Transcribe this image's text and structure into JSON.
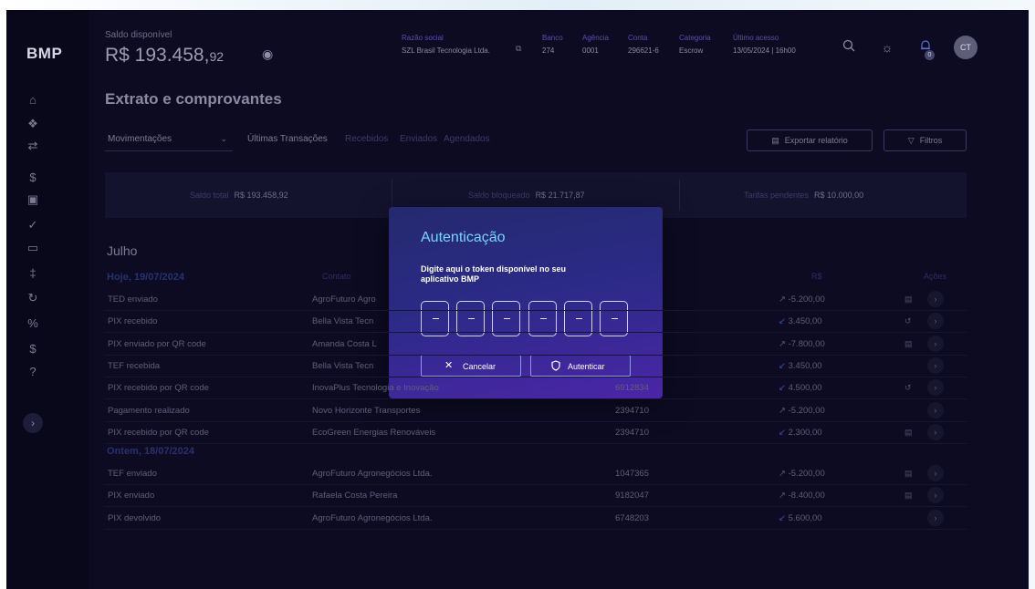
{
  "brand": {
    "logo": "BMP"
  },
  "header": {
    "balance_label": "Saldo disponível",
    "balance_main": "R$ 193.458,",
    "balance_cents": "92",
    "company_label": "Razão social",
    "company_value": "SZL Brasil Tecnologia Ltda.",
    "bank_label": "Banco",
    "bank_value": "274",
    "agency_label": "Agência",
    "agency_value": "0001",
    "account_label": "Conta",
    "account_value": "296621-6",
    "category_label": "Categoria",
    "category_value": "Escrow",
    "last_access_label": "Último acesso",
    "last_access_value": "13/05/2024 | 16h00",
    "notification_count": "0",
    "avatar": "CT"
  },
  "page": {
    "title": "Extrato e comprovantes",
    "select_value": "Movimentações",
    "tabs": [
      "Últimas Transações",
      "Recebidos",
      "Enviados",
      "Agendados"
    ],
    "export_label": "Exportar relatório",
    "filters_label": "Filtros"
  },
  "summary": {
    "total_label": "Saldo total",
    "total_value": "R$ 193.458,92",
    "blocked_label": "Saldo bloqueado",
    "blocked_value": "R$ 21.717,87",
    "fees_label": "Tarifas pendentes",
    "fees_value": "R$ 10.000,00"
  },
  "list": {
    "month": "Julho",
    "columns": {
      "contact": "Contato",
      "value": "R$",
      "actions": "Ações"
    },
    "groups": [
      {
        "day": "Hoje, 19/07/2024",
        "rows": [
          {
            "desc": "TED enviado",
            "contact": "AgroFuturo Agro",
            "doc": "",
            "value": "-5.200,00",
            "dir": "out",
            "act": "doc"
          },
          {
            "desc": "PIX recebido",
            "contact": "Bella Vista Tecn",
            "doc": "",
            "value": "3.450,00",
            "dir": "in",
            "act": "undo"
          },
          {
            "desc": "PIX enviado por QR code",
            "contact": "Amanda Costa L",
            "doc": "",
            "value": "-7.800,00",
            "dir": "out",
            "act": "doc"
          },
          {
            "desc": "TEF recebida",
            "contact": "Bella Vista Tecn",
            "doc": "",
            "value": "3.450,00",
            "dir": "in",
            "act": ""
          },
          {
            "desc": "PIX recebido por QR code",
            "contact": "InovaPlus Tecnologia e Inovação",
            "doc": "6912834",
            "value": "4.500,00",
            "dir": "in",
            "act": "undo"
          },
          {
            "desc": "Pagamento realizado",
            "contact": "Novo Horizonte Transportes",
            "doc": "2394710",
            "value": "-5.200,00",
            "dir": "out",
            "act": ""
          },
          {
            "desc": "PIX recebido por QR code",
            "contact": "EcoGreen Energias Renováveis",
            "doc": "2394710",
            "value": "2.300,00",
            "dir": "in",
            "act": "doc"
          }
        ]
      },
      {
        "day": "Ontem, 18/07/2024",
        "rows": [
          {
            "desc": "TEF enviado",
            "contact": "AgroFuturo Agronegócios Ltda.",
            "doc": "1047365",
            "value": "-5.200,00",
            "dir": "out",
            "act": "doc"
          },
          {
            "desc": "PIX enviado",
            "contact": "Rafaela Costa Pereira",
            "doc": "9182047",
            "value": "-8.400,00",
            "dir": "out",
            "act": "doc"
          },
          {
            "desc": "PIX devolvido",
            "contact": "AgroFuturo Agronegócios Ltda.",
            "doc": "6748203",
            "value": "5.600,00",
            "dir": "in",
            "act": ""
          }
        ]
      }
    ]
  },
  "modal": {
    "title": "Autenticação",
    "description": "Digite aqui o token disponível no seu aplicativo BMP",
    "digits": [
      "",
      "",
      "",
      "",
      "",
      ""
    ],
    "cancel_label": "Cancelar",
    "confirm_label": "Autenticar"
  }
}
